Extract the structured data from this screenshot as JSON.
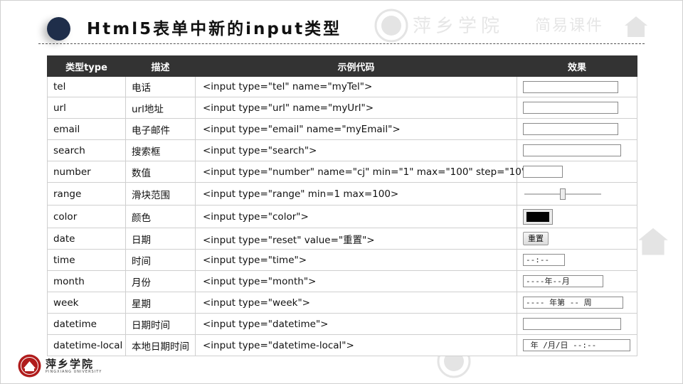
{
  "slide": {
    "title": "Html5表单中新的input类型",
    "watermark": {
      "name": "萍乡学院",
      "label": "简易课件"
    },
    "footer": {
      "name": "萍乡学院",
      "subtitle": "PINGXIANG UNIVERSITY"
    }
  },
  "table": {
    "headers": [
      "类型type",
      "描述",
      "示例代码",
      "效果"
    ],
    "rows": [
      {
        "type": "tel",
        "desc": "电话",
        "code": "<input type=\"tel\" name=\"myTel\">"
      },
      {
        "type": "url",
        "desc": "url地址",
        "code": "<input type=\"url\" name=\"myUrl\">"
      },
      {
        "type": "email",
        "desc": "电子邮件",
        "code": "<input type=\"email\" name=\"myEmail\">"
      },
      {
        "type": "search",
        "desc": "搜索框",
        "code": "<input type=\"search\">"
      },
      {
        "type": "number",
        "desc": "数值",
        "code": "<input type=\"number\" name=\"cj\" min=\"1\" max=\"100\" step=\"10\">"
      },
      {
        "type": "range",
        "desc": "滑块范围",
        "code": "<input type=\"range\" min=1 max=100>",
        "value_fraction": 0.5
      },
      {
        "type": "color",
        "desc": "颜色",
        "code": "<input type=\"color\">",
        "value_color": "#000000"
      },
      {
        "type": "date",
        "desc": "日期",
        "code": "<input type=\"reset\" value=\"重置\">",
        "button_label": "重置"
      },
      {
        "type": "time",
        "desc": "时间",
        "code": "<input type=\"time\">",
        "display": "--:--"
      },
      {
        "type": "month",
        "desc": "月份",
        "code": "<input type=\"month\">",
        "display": "----年--月"
      },
      {
        "type": "week",
        "desc": "星期",
        "code": "<input type=\"week\">",
        "display": "---- 年第 -- 周"
      },
      {
        "type": "datetime",
        "desc": "日期时间",
        "code": "<input type=\"datetime\">"
      },
      {
        "type": "datetime-local",
        "desc": "本地日期时间",
        "code": "<input type=\"datetime-local\">",
        "display": " 年 /月/日 --:--"
      }
    ]
  },
  "colors": {
    "header_bg": "#333333",
    "title_dot": "#1f2e4a",
    "seal": "#b01c1c"
  }
}
